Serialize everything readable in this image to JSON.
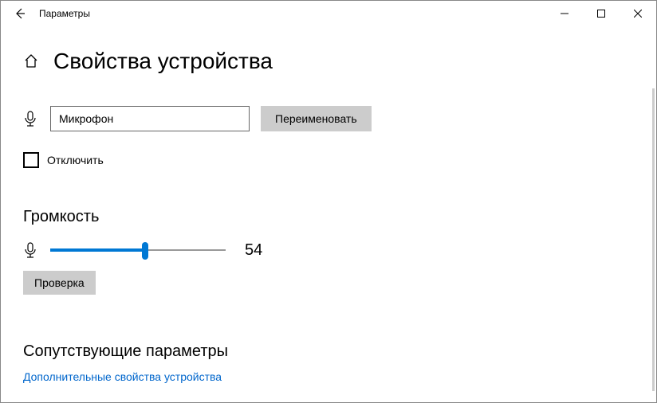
{
  "window": {
    "title": "Параметры"
  },
  "page": {
    "title": "Свойства устройства"
  },
  "device": {
    "name": "Микрофон",
    "rename_label": "Переименовать"
  },
  "disable": {
    "label": "Отключить"
  },
  "volume": {
    "section_title": "Громкость",
    "value": "54",
    "percent": 54,
    "test_label": "Проверка"
  },
  "related": {
    "title": "Сопутствующие параметры",
    "link": "Дополнительные свойства устройства"
  }
}
